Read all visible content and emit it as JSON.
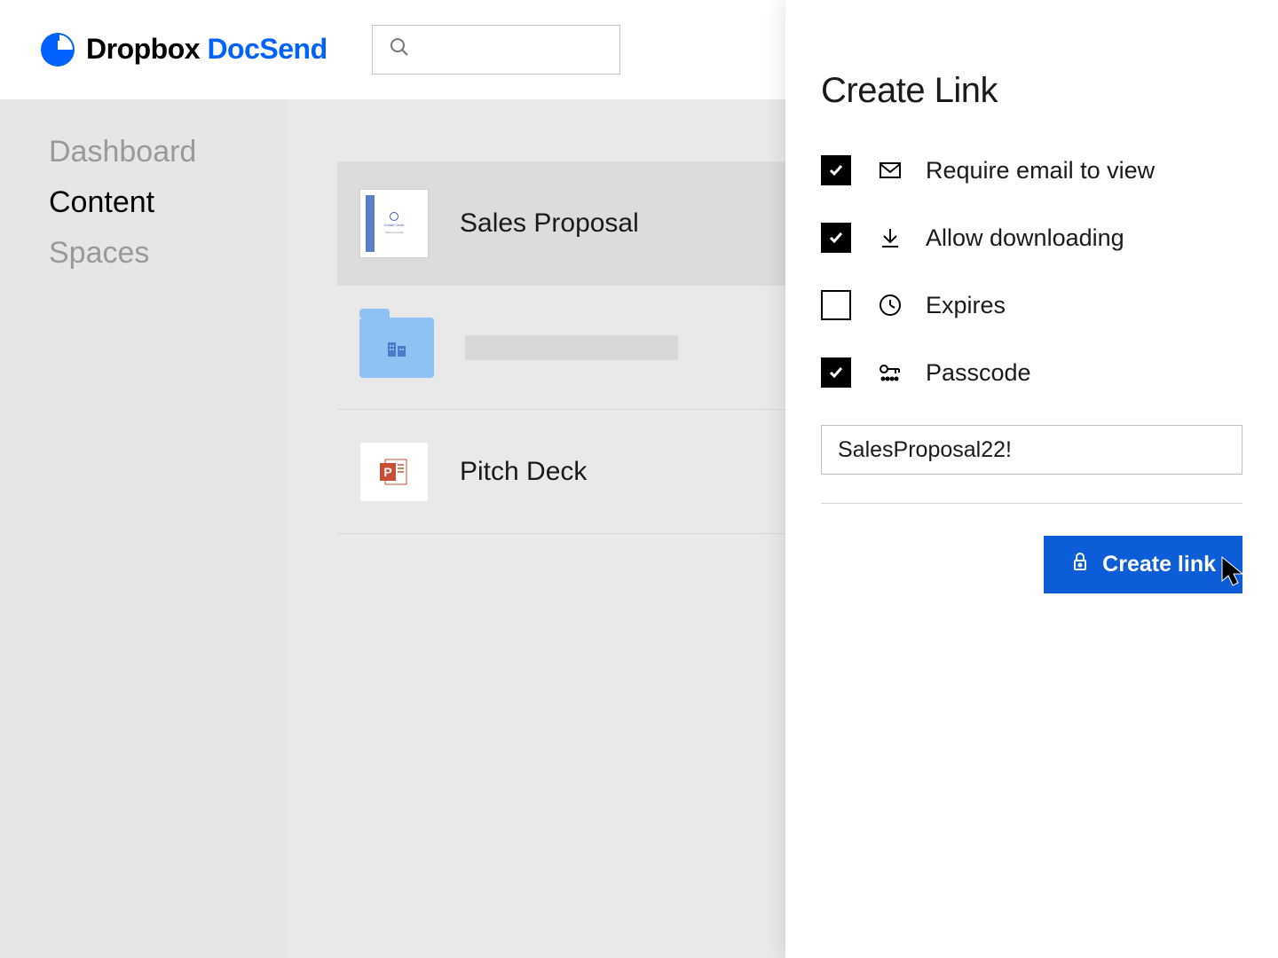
{
  "brand": {
    "dropbox": "Dropbox",
    "docsend": "DocSend"
  },
  "sidebar": {
    "items": [
      {
        "label": "Dashboard",
        "active": false
      },
      {
        "label": "Content",
        "active": true
      },
      {
        "label": "Spaces",
        "active": false
      }
    ]
  },
  "content": {
    "items": [
      {
        "title": "Sales Proposal",
        "type": "doc"
      },
      {
        "title": "",
        "type": "folder"
      },
      {
        "title": "Pitch Deck",
        "type": "ppt"
      }
    ]
  },
  "panel": {
    "title": "Create Link",
    "options": [
      {
        "label": "Require email to view",
        "checked": true,
        "icon": "mail"
      },
      {
        "label": "Allow downloading",
        "checked": true,
        "icon": "download"
      },
      {
        "label": "Expires",
        "checked": false,
        "icon": "clock"
      },
      {
        "label": "Passcode",
        "checked": true,
        "icon": "key"
      }
    ],
    "passcode_value": "SalesProposal22!",
    "create_button": "Create link"
  }
}
